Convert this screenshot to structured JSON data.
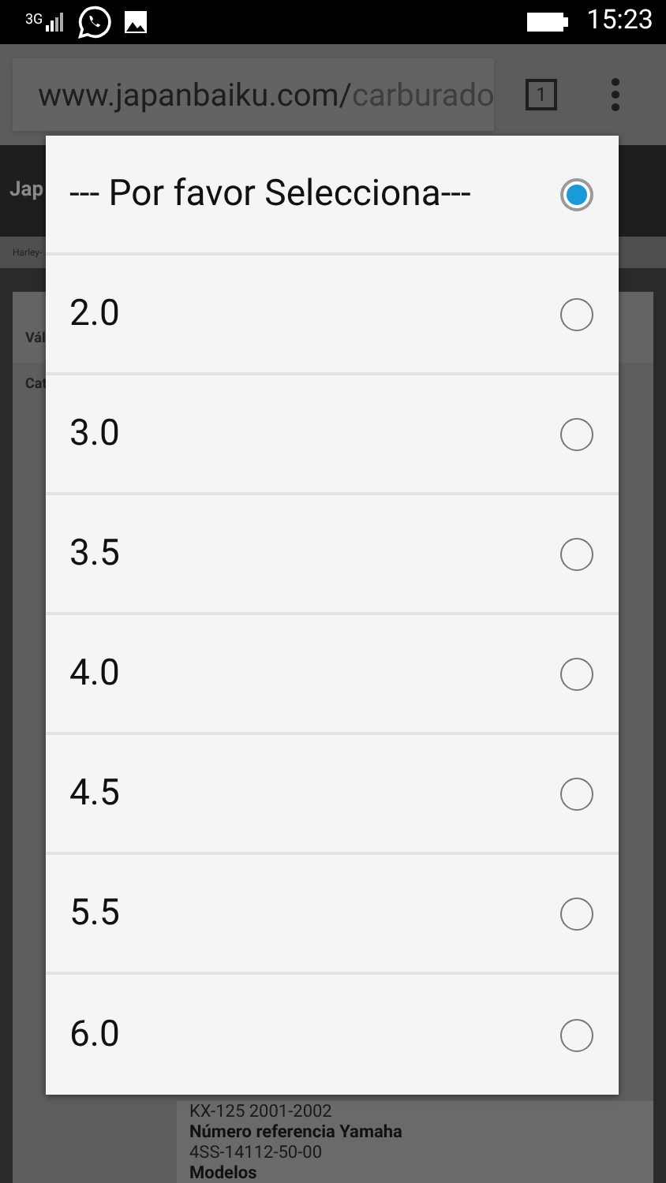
{
  "status_bar": {
    "network": "3G",
    "time": "15:23"
  },
  "browser": {
    "url_host": "www.japanbaiku.com/",
    "url_path": "carburado",
    "tab_count": "1"
  },
  "page": {
    "header_title": "Jap",
    "nav_item": "Harley-",
    "card_title": "Vál",
    "section_title": "Cat",
    "details": [
      {
        "kind": "value",
        "text": "KX-125 2001-2002"
      },
      {
        "kind": "label",
        "text": "Número referencia Yamaha"
      },
      {
        "kind": "value",
        "text": "4SS-14112-50-00"
      },
      {
        "kind": "label",
        "text": "Modelos"
      }
    ]
  },
  "dialog": {
    "options": [
      {
        "label": "--- Por favor Selecciona---",
        "selected": true
      },
      {
        "label": "2.0",
        "selected": false
      },
      {
        "label": "3.0",
        "selected": false
      },
      {
        "label": "3.5",
        "selected": false
      },
      {
        "label": "4.0",
        "selected": false
      },
      {
        "label": "4.5",
        "selected": false
      },
      {
        "label": "5.5",
        "selected": false
      },
      {
        "label": "6.0",
        "selected": false
      }
    ]
  }
}
